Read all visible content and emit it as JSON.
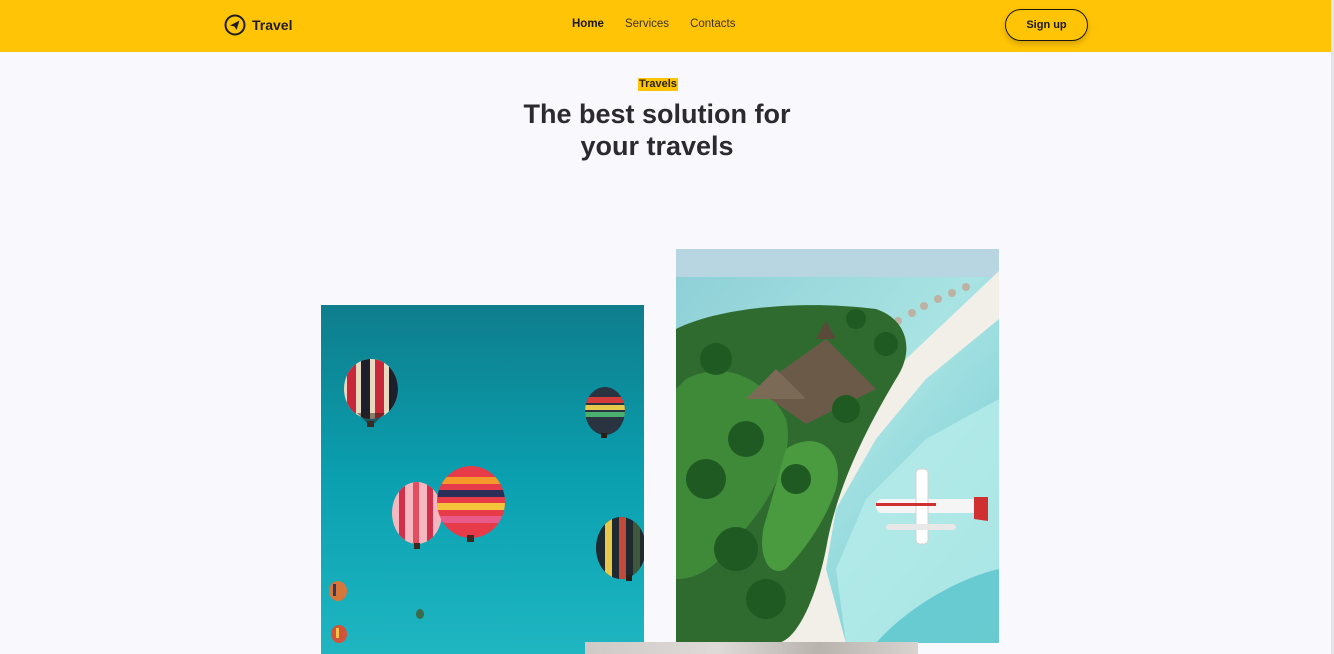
{
  "header": {
    "brand_name": "Travel",
    "brand_icon": "paper-plane-icon",
    "nav": [
      {
        "label": "Home",
        "active": true
      },
      {
        "label": "Services",
        "active": false
      },
      {
        "label": "Contacts",
        "active": false
      }
    ],
    "signup_label": "Sign up"
  },
  "hero": {
    "tag": "Travels",
    "title_line1": "The best solution for",
    "title_line2": "your travels"
  },
  "gallery": {
    "images": [
      {
        "subject": "hot-air-balloons"
      },
      {
        "subject": "tropical-island-seaplane"
      },
      {
        "subject": "partially-visible-photo"
      }
    ]
  },
  "colors": {
    "accent": "#ffc405",
    "page_bg": "#f9f8fc",
    "text_dark": "#2c2a2f"
  }
}
